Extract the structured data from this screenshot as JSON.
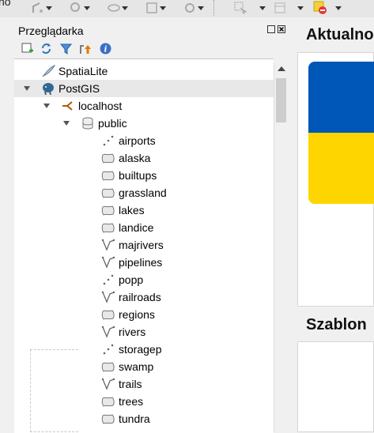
{
  "topbar": {
    "clipped_text": "no"
  },
  "browser_panel": {
    "title": "Przeglądarka",
    "tree": [
      {
        "label": "SpatiaLite",
        "icon": "feather-icon",
        "level": 0,
        "expanded": null
      },
      {
        "label": "PostGIS",
        "icon": "elephant-icon",
        "level": 0,
        "expanded": true,
        "selected": true
      },
      {
        "label": "localhost",
        "icon": "connection-icon",
        "level": 1,
        "expanded": true
      },
      {
        "label": "public",
        "icon": "database-schema-icon",
        "level": 2,
        "expanded": true
      },
      {
        "label": "airports",
        "icon": "point-layer-icon",
        "level": 3
      },
      {
        "label": "alaska",
        "icon": "polygon-layer-icon",
        "level": 3
      },
      {
        "label": "builtups",
        "icon": "polygon-layer-icon",
        "level": 3
      },
      {
        "label": "grassland",
        "icon": "polygon-layer-icon",
        "level": 3
      },
      {
        "label": "lakes",
        "icon": "polygon-layer-icon",
        "level": 3
      },
      {
        "label": "landice",
        "icon": "polygon-layer-icon",
        "level": 3
      },
      {
        "label": "majrivers",
        "icon": "line-layer-icon",
        "level": 3
      },
      {
        "label": "pipelines",
        "icon": "line-layer-icon",
        "level": 3
      },
      {
        "label": "popp",
        "icon": "point-layer-icon",
        "level": 3
      },
      {
        "label": "railroads",
        "icon": "line-layer-icon",
        "level": 3
      },
      {
        "label": "regions",
        "icon": "polygon-layer-icon",
        "level": 3
      },
      {
        "label": "rivers",
        "icon": "line-layer-icon",
        "level": 3
      },
      {
        "label": "storagep",
        "icon": "point-layer-icon",
        "level": 3
      },
      {
        "label": "swamp",
        "icon": "polygon-layer-icon",
        "level": 3
      },
      {
        "label": "trails",
        "icon": "line-layer-icon",
        "level": 3
      },
      {
        "label": "trees",
        "icon": "polygon-layer-icon",
        "level": 3
      },
      {
        "label": "tundra",
        "icon": "polygon-layer-icon",
        "level": 3
      }
    ]
  },
  "right_panel": {
    "heading_top": "Aktualno",
    "heading_bottom": "Szablon"
  },
  "colors": {
    "flag_blue": "#0057b7",
    "flag_yellow": "#ffd500",
    "postgis_blue": "#336791"
  }
}
